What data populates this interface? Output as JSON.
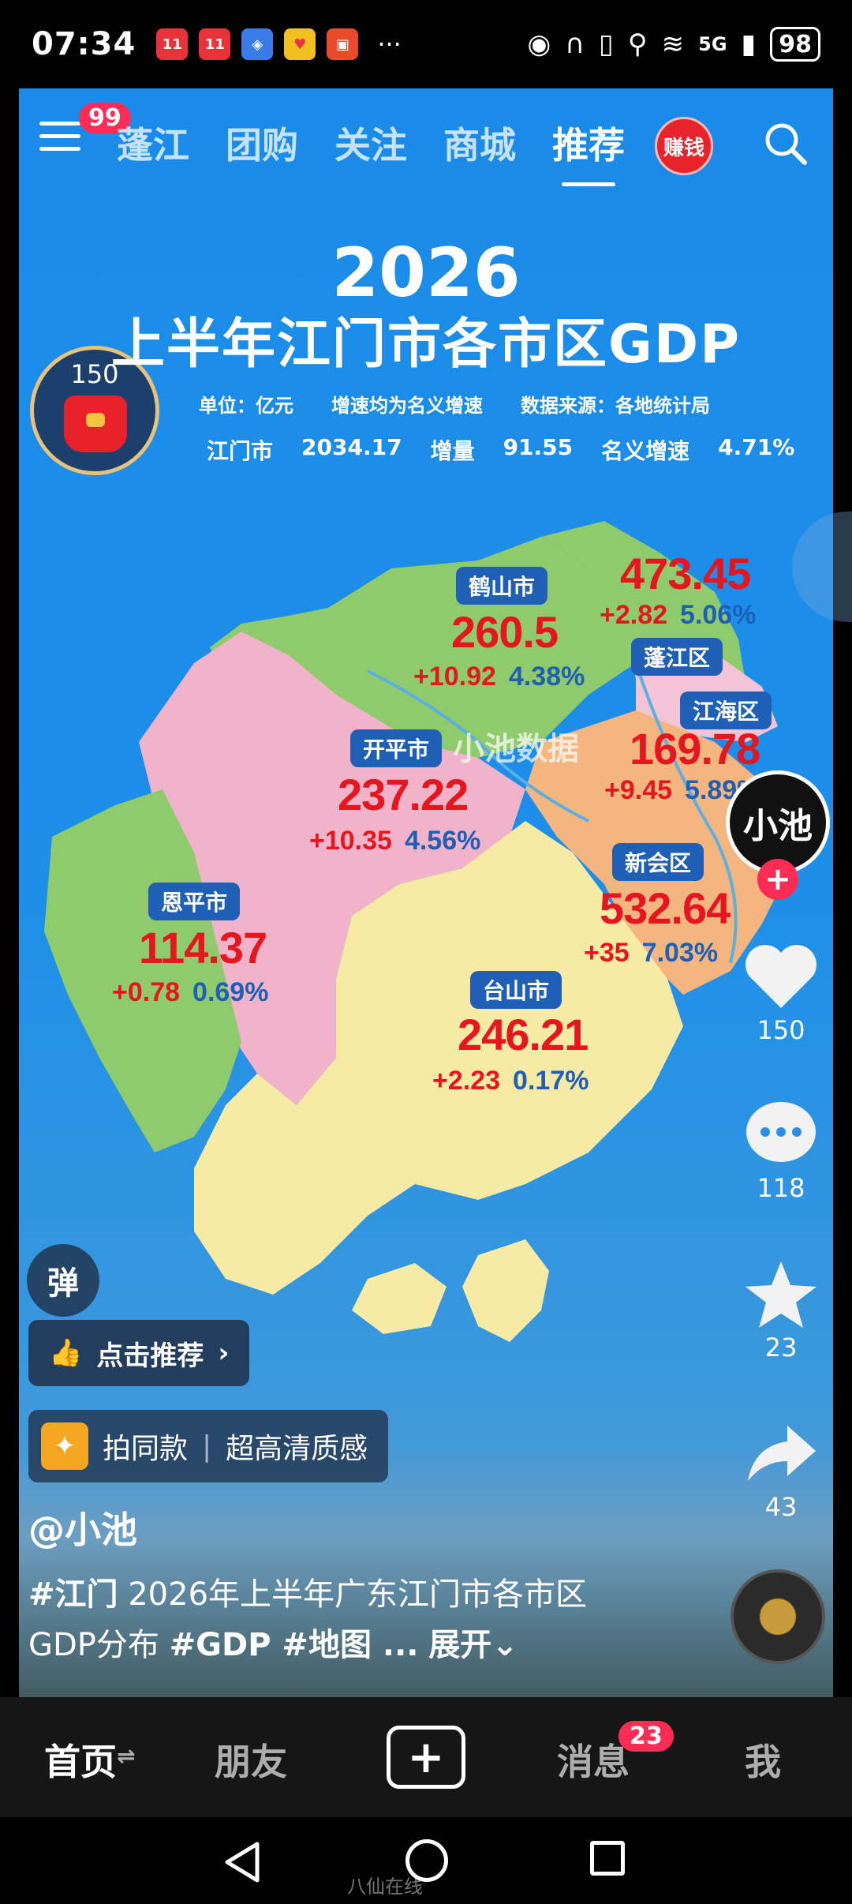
{
  "status_bar": {
    "time": "07:34",
    "notification_icons": [
      "app-icon-1",
      "app-icon-2",
      "app-icon-3",
      "app-icon-4",
      "app-icon-5"
    ],
    "more": "···",
    "network": "5G",
    "battery": "98"
  },
  "top_nav": {
    "menu_badge": "99",
    "tabs": [
      "蓬江",
      "团购",
      "关注",
      "商城",
      "推荐"
    ],
    "active_tab": "推荐",
    "earn_label": "赚钱"
  },
  "red_packet": {
    "count": "150"
  },
  "infographic": {
    "year": "2026",
    "title": "上半年江门市各市区GDP",
    "unit": "单位：亿元",
    "note": "增速均为名义增速",
    "source": "数据来源：各地统计局",
    "city_name": "江门市",
    "city_value": "2034.17",
    "increase_label": "增量",
    "increase_value": "91.55",
    "growth_label": "名义增速",
    "growth_value": "4.71%",
    "watermark": "小池数据",
    "regions": [
      {
        "name": "鹤山市",
        "gdp": "260.5",
        "increase": "+10.92",
        "rate": "4.38%"
      },
      {
        "name": "蓬江区",
        "gdp": "473.45",
        "increase": "+2.82",
        "rate": "5.06%"
      },
      {
        "name": "江海区",
        "gdp": "169.78",
        "increase": "+9.45",
        "rate": "5.89%"
      },
      {
        "name": "开平市",
        "gdp": "237.22",
        "increase": "+10.35",
        "rate": "4.56%"
      },
      {
        "name": "新会区",
        "gdp": "532.64",
        "increase": "+35",
        "rate": "7.03%"
      },
      {
        "name": "恩平市",
        "gdp": "114.37",
        "increase": "+0.78",
        "rate": "0.69%"
      },
      {
        "name": "台山市",
        "gdp": "246.21",
        "increase": "+2.23",
        "rate": "0.17%"
      }
    ],
    "colors": {
      "heshan": "#8fca6c",
      "pengjiang_jianghai": "#f2c98a",
      "kaiping": "#f0b3c9",
      "xinhui": "#f5b57e",
      "enping": "#8fca6c",
      "taishan": "#f7eaa4",
      "value_red": "#e5161e",
      "rate_blue": "#1f5fb5"
    }
  },
  "side_actions": {
    "avatar_text": "小池",
    "like_count": "150",
    "comment_count": "118",
    "favorite_count": "23",
    "share_count": "43"
  },
  "overlay": {
    "danmu": "弹",
    "recommend": "点击推荐",
    "same_style": "拍同款",
    "quality": "超高清质感",
    "author": "@小池",
    "desc_tag1": "#江门",
    "desc_text": " 2026年上半年广东江门市各市区GDP分布 ",
    "desc_tag2": "#GDP #地图 ...",
    "expand": "展开"
  },
  "bottom_nav": {
    "home": "首页",
    "friends": "朋友",
    "messages": "消息",
    "messages_badge": "23",
    "me": "我"
  },
  "watermark_footer": "八仙在线"
}
